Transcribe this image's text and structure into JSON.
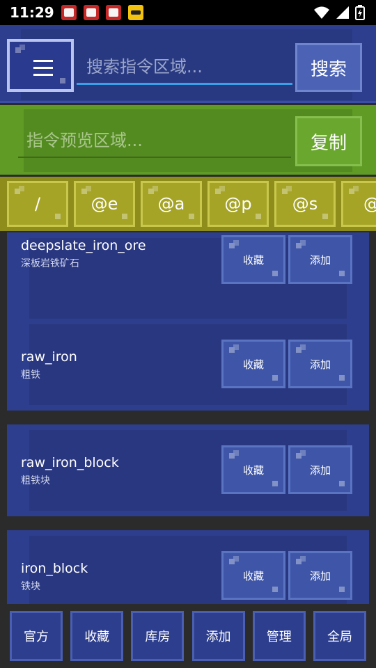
{
  "status_bar": {
    "time": "11:29",
    "notification_icons": [
      "app-notification-icon",
      "app-notification-icon",
      "app-notification-icon",
      "app-notification-icon"
    ],
    "right_icons": [
      "wifi-icon",
      "signal-icon",
      "battery-charging-icon"
    ]
  },
  "search": {
    "placeholder": "搜索指令区域...",
    "button_label": "搜索"
  },
  "preview": {
    "placeholder": "指令预览区域...",
    "button_label": "复制"
  },
  "selectors": [
    "/",
    "@e",
    "@a",
    "@p",
    "@s",
    "@"
  ],
  "items": [
    {
      "id": "deepslate_iron_ore",
      "name": "深板岩铁矿石",
      "fav_label": "收藏",
      "add_label": "添加"
    },
    {
      "id": "raw_iron",
      "name": "粗铁",
      "fav_label": "收藏",
      "add_label": "添加"
    },
    {
      "id": "raw_iron_block",
      "name": "粗铁块",
      "fav_label": "收藏",
      "add_label": "添加"
    },
    {
      "id": "iron_block",
      "name": "铁块",
      "fav_label": "收藏",
      "add_label": "添加"
    }
  ],
  "bottom_nav": [
    "官方",
    "收藏",
    "库房",
    "添加",
    "管理",
    "全局"
  ],
  "colors": {
    "primary_blue": "#2d3e8e",
    "preview_green": "#5f9b25",
    "selector_olive": "#8e8d1c",
    "accent_cyan": "#3aa0e8"
  }
}
